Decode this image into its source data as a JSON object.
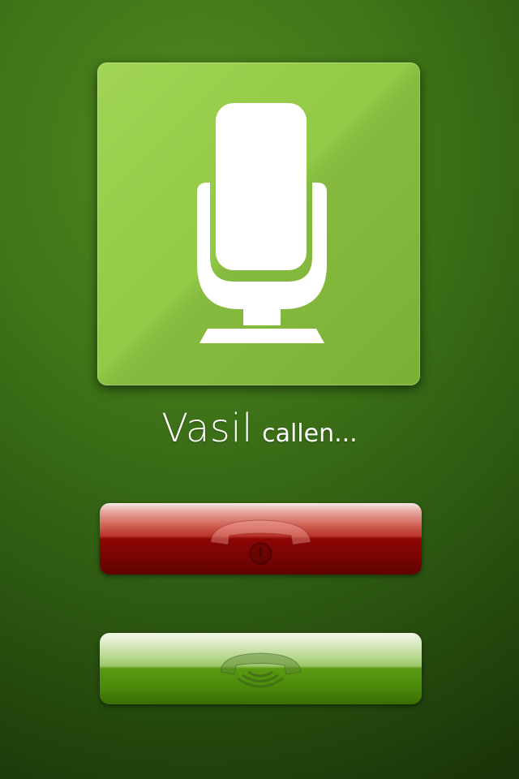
{
  "caller": {
    "name": "Vasil",
    "status": "callen..."
  },
  "icons": {
    "avatar": "microphone-icon",
    "decline": "hang-up-phone-icon",
    "answer": "answer-phone-icon"
  },
  "colors": {
    "background": "#3f7418",
    "tile": "#93c947",
    "decline": "#8c0605",
    "answer": "#5a9a12"
  }
}
